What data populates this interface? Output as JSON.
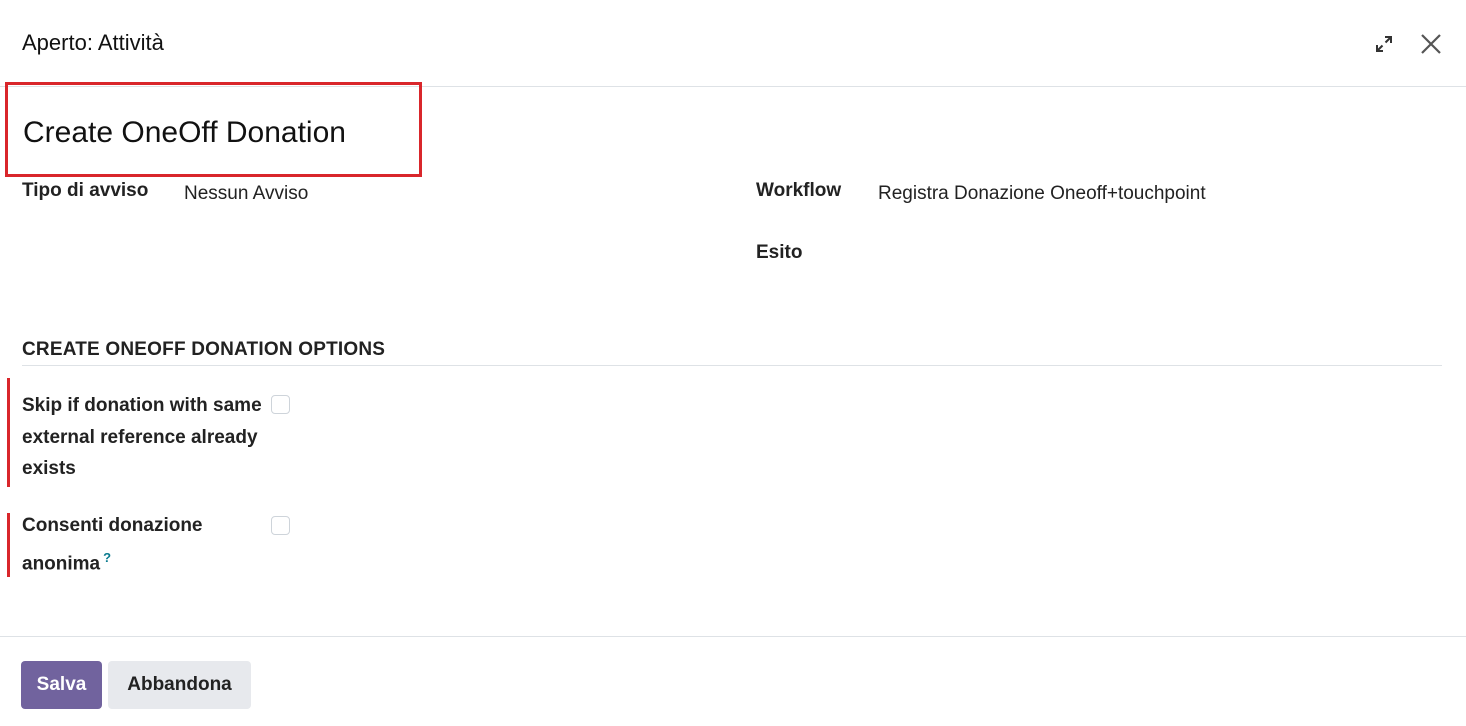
{
  "header": {
    "title": "Aperto: Attività",
    "expand_icon": "expand-arrows-icon",
    "close_icon": "close-icon"
  },
  "record": {
    "title": "Create OneOff Donation"
  },
  "fields": {
    "tipo_di_avviso": {
      "label": "Tipo di avviso",
      "value": "Nessun Avviso"
    },
    "workflow": {
      "label": "Workflow",
      "value": "Registra Donazione Oneoff+touchpoint"
    },
    "esito": {
      "label": "Esito",
      "value": ""
    }
  },
  "section": {
    "title": "CREATE ONEOFF DONATION OPTIONS",
    "options": [
      {
        "label": "Skip if donation with same external reference already exists",
        "checked": false
      },
      {
        "label": "Consenti donazione anonima",
        "help": "?",
        "checked": false
      }
    ]
  },
  "footer": {
    "save_label": "Salva",
    "discard_label": "Abbandona"
  },
  "colors": {
    "primary": "#71639e",
    "secondary": "#e7e9ed",
    "required_marker": "#d9262b",
    "help_mark": "#0b7b8f"
  }
}
